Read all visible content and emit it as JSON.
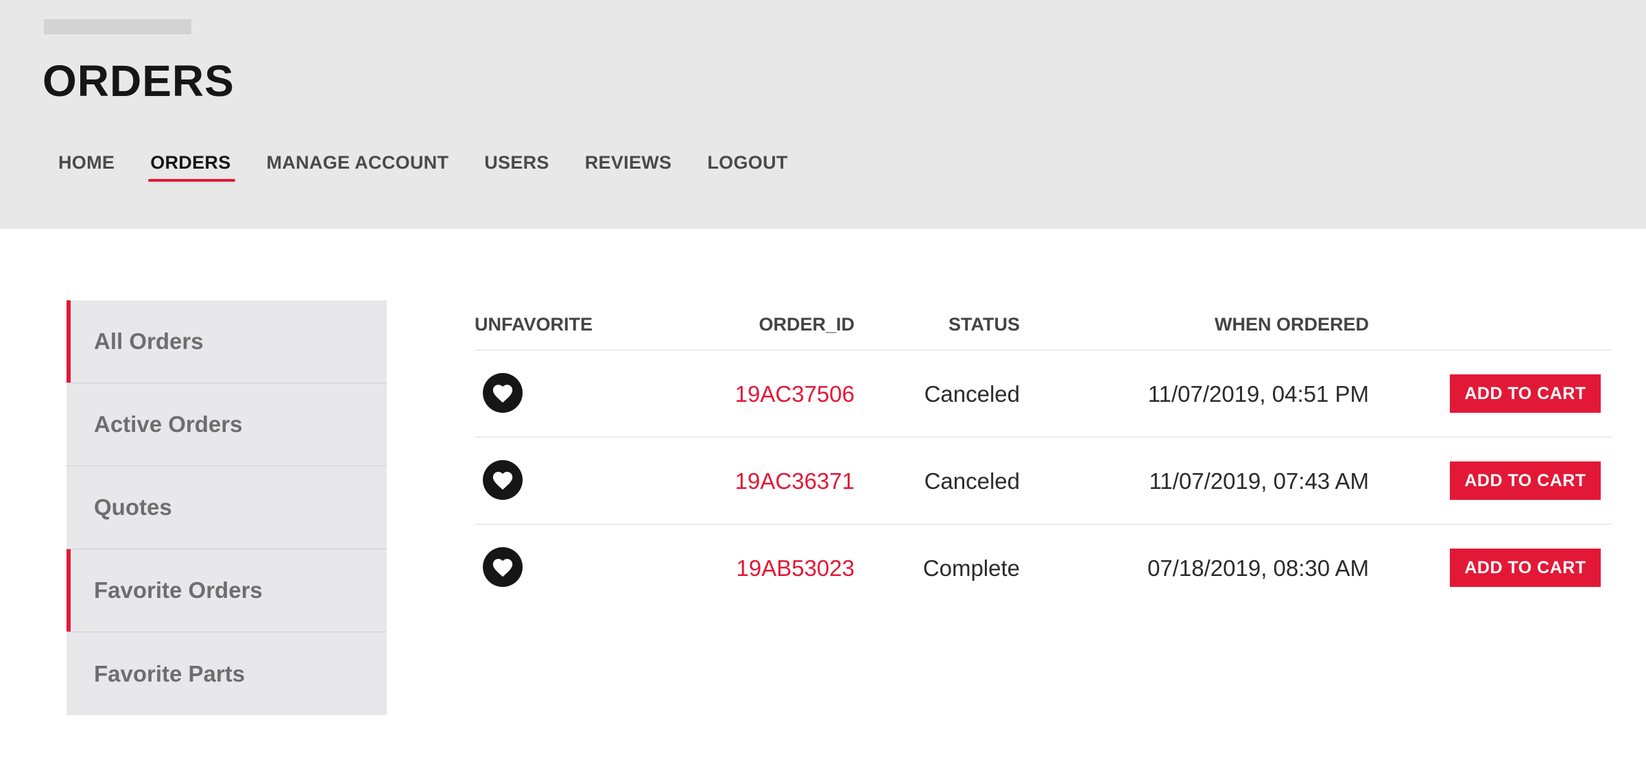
{
  "header": {
    "title": "ORDERS"
  },
  "nav": {
    "items": [
      {
        "label": "HOME"
      },
      {
        "label": "ORDERS"
      },
      {
        "label": "MANAGE ACCOUNT"
      },
      {
        "label": "USERS"
      },
      {
        "label": "REVIEWS"
      },
      {
        "label": "LOGOUT"
      }
    ],
    "active": "ORDERS"
  },
  "sidebar": {
    "items": [
      {
        "label": "All Orders"
      },
      {
        "label": "Active Orders"
      },
      {
        "label": "Quotes"
      },
      {
        "label": "Favorite Orders"
      },
      {
        "label": "Favorite Parts"
      }
    ]
  },
  "table": {
    "headers": {
      "unfavorite": "UNFAVORITE",
      "order_id": "ORDER_ID",
      "status": "STATUS",
      "when_ordered": "WHEN ORDERED"
    },
    "rows": [
      {
        "order_id": "19AC37506",
        "status": "Canceled",
        "when_ordered": "11/07/2019, 04:51 PM",
        "action": "ADD TO CART"
      },
      {
        "order_id": "19AC36371",
        "status": "Canceled",
        "when_ordered": "11/07/2019, 07:43 AM",
        "action": "ADD TO CART"
      },
      {
        "order_id": "19AB53023",
        "status": "Complete",
        "when_ordered": "07/18/2019, 08:30 AM",
        "action": "ADD TO CART"
      }
    ]
  },
  "icons": {
    "favorite": "heart-icon"
  },
  "colors": {
    "accent": "#e31837",
    "header_bg": "#e8e8e8",
    "sidebar_bg": "#e8e8ea",
    "heart_bg": "#161616"
  }
}
